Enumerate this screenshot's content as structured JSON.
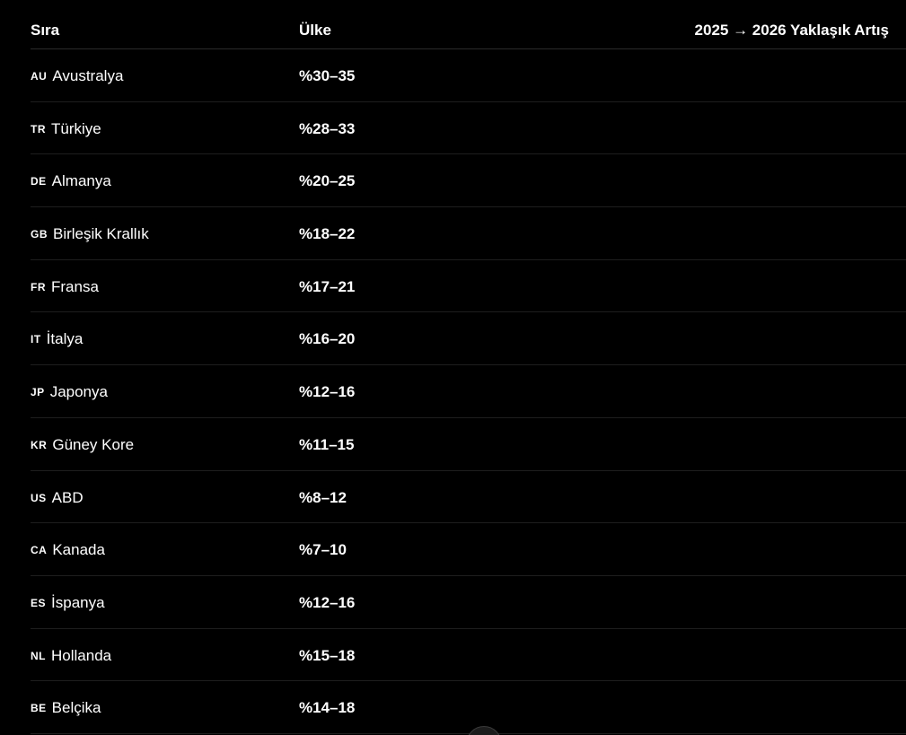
{
  "table": {
    "headers": {
      "rank": "Sıra",
      "country": "Ülke",
      "increase": "2025 → 2026 Yaklaşık Artış"
    },
    "rows": [
      {
        "code": "AU",
        "country": "Avustralya",
        "value": "%30–35"
      },
      {
        "code": "TR",
        "country": "Türkiye",
        "value": "%28–33"
      },
      {
        "code": "DE",
        "country": "Almanya",
        "value": "%20–25"
      },
      {
        "code": "GB",
        "country": "Birleşik Krallık",
        "value": "%18–22"
      },
      {
        "code": "FR",
        "country": "Fransa",
        "value": "%17–21"
      },
      {
        "code": "IT",
        "country": "İtalya",
        "value": "%16–20"
      },
      {
        "code": "JP",
        "country": "Japonya",
        "value": "%12–16"
      },
      {
        "code": "KR",
        "country": "Güney Kore",
        "value": "%11–15"
      },
      {
        "code": "US",
        "country": "ABD",
        "value": "%8–12"
      },
      {
        "code": "CA",
        "country": "Kanada",
        "value": "%7–10"
      },
      {
        "code": "ES",
        "country": "İspanya",
        "value": "%12–16"
      },
      {
        "code": "NL",
        "country": "Hollanda",
        "value": "%15–18"
      },
      {
        "code": "BE",
        "country": "Belçika",
        "value": "%14–18"
      }
    ]
  },
  "colors": {
    "background": "#000000",
    "text": "#ffffff",
    "divider": "#1e1e1e"
  },
  "icons": {
    "scroll_button": "scroll-down-icon"
  }
}
